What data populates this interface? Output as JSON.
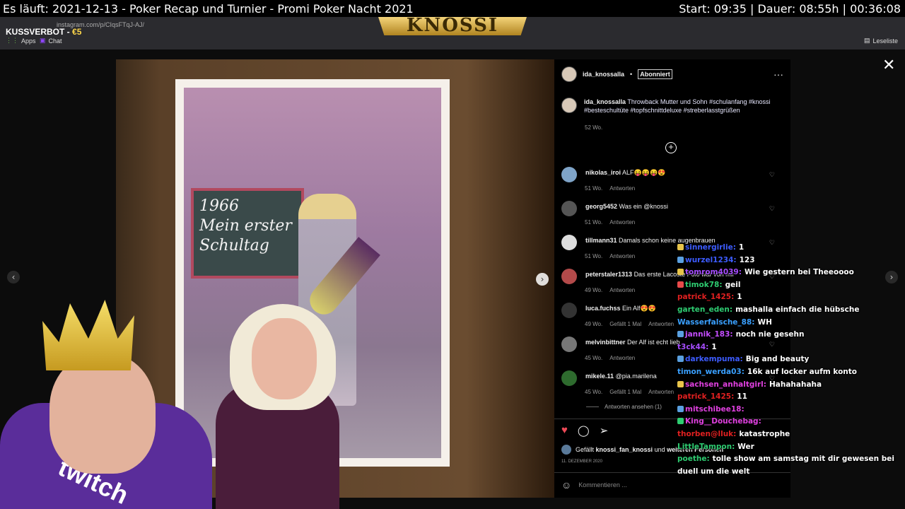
{
  "overlay": {
    "title": "Es läuft: 2021-12-13 - Poker Recap und Turnier - Promi Poker Nacht 2021",
    "time_info": "Start: 09:35 | Dauer: 08:55h | 00:36:08",
    "kuss_label": "KUSSVERBOT - ",
    "kuss_amount": "€5",
    "brand_logo": "KNOSSI"
  },
  "browser": {
    "url": "instagram.com/p/CIqsFTqJ-AJ/",
    "bookmarks": [
      "Apps",
      "Chat"
    ],
    "reading_list": "Leseliste"
  },
  "post": {
    "board_line1": "1966",
    "board_line2": "Mein erster",
    "board_line3": "Schultag"
  },
  "instagram": {
    "username": "ida_knossalla",
    "separator": "•",
    "follow_state": "Abonniert",
    "more": "···",
    "caption_user": "ida_knossalla",
    "caption_text": "Throwback Mutter und Sohn #schulanfang #knossi #besteschultüte #topfschnittdeluxe #streberlasstgrüßen",
    "caption_time": "52 Wo.",
    "comments": [
      {
        "user": "nikolas_iroi",
        "text": "ALF😝😝😝😍",
        "time": "51 Wo.",
        "likes": "",
        "reply": "Antworten",
        "avatar_color": "#7fa4c8"
      },
      {
        "user": "georg5452",
        "text": "Was ein @knossi",
        "time": "51 Wo.",
        "likes": "",
        "reply": "Antworten",
        "avatar_color": "#555"
      },
      {
        "user": "tillmann31",
        "text": "Damals schon keine augenbrauen",
        "time": "51 Wo.",
        "likes": "",
        "reply": "Antworten",
        "avatar_color": "#ddd"
      },
      {
        "user": "peterstaler1313",
        "text": "Das erste Lacoste Polo war von mir",
        "time": "49 Wo.",
        "likes": "",
        "reply": "Antworten",
        "avatar_color": "#b34a4a"
      },
      {
        "user": "luca.fuchss",
        "text": "Ein Alf😍😍",
        "time": "49 Wo.",
        "likes": "Gefällt 1 Mal",
        "reply": "Antworten",
        "avatar_color": "#333"
      },
      {
        "user": "melvinbittner",
        "text": "Der Alf ist echt lieb",
        "time": "45 Wo.",
        "likes": "",
        "reply": "Antworten",
        "avatar_color": "#777"
      },
      {
        "user": "mikele.11",
        "text": "@pia.marilena",
        "time": "45 Wo.",
        "likes": "Gefällt 1 Mal",
        "reply": "Antworten",
        "avatar_color": "#2e6b2e"
      }
    ],
    "view_replies": "Antworten ansehen (1)",
    "likes_prefix": "Gefällt ",
    "likes_user": "knossi_fan_knossi",
    "likes_mid": " und ",
    "likes_rest": "weiteren Personen",
    "date": "11. DEZEMBER 2020",
    "comment_placeholder": "Kommentieren ..."
  },
  "chat": [
    {
      "user": "sinnergirlie:",
      "text": "1",
      "color": "#3d5cff",
      "badge": "#e8c44a"
    },
    {
      "user": "wurzel1234:",
      "text": "123",
      "color": "#3d5cff",
      "badge": "#5aa0e0"
    },
    {
      "user": "tomrom4039:",
      "text": "Wie gestern bei Theeoooo",
      "color": "#a64dff",
      "badge": "#e8c44a"
    },
    {
      "user": "timok78:",
      "text": "geil",
      "color": "#2ecc71",
      "badge": "#e84a4a"
    },
    {
      "user": "patrick_1425:",
      "text": "1",
      "color": "#e02020",
      "badge": ""
    },
    {
      "user": "garten_eden:",
      "text": "mashalla einfach die hübsche",
      "color": "#2ecc71",
      "badge": ""
    },
    {
      "user": "Wasserfalsche_88:",
      "text": "WH",
      "color": "#3aa0ff",
      "badge": ""
    },
    {
      "user": "jannik_183:",
      "text": "noch nie gesehn",
      "color": "#c44dff",
      "badge": "#5aa0e0"
    },
    {
      "user": "t3ck44:",
      "text": "1",
      "color": "#a64dff",
      "badge": ""
    },
    {
      "user": "darkempuma:",
      "text": "Big and beauty",
      "color": "#3d5cff",
      "badge": "#5aa0e0"
    },
    {
      "user": "timon_werda03:",
      "text": "16k auf locker aufm konto",
      "color": "#3aa0ff",
      "badge": ""
    },
    {
      "user": "sachsen_anhaltgirl:",
      "text": "Hahahahaha",
      "color": "#e040e0",
      "badge": "#e8c44a"
    },
    {
      "user": "patrick_1425:",
      "text": "11",
      "color": "#e02020",
      "badge": ""
    },
    {
      "user": "mitschibee18:",
      "text": "",
      "color": "#e040e0",
      "badge": "#5aa0e0"
    },
    {
      "user": "King__Douchebag:",
      "text": "",
      "color": "#e040e0",
      "badge": "#2ecc71"
    },
    {
      "user": "thorben@lluk:",
      "text": "katastrophe",
      "color": "#e02020",
      "badge": ""
    },
    {
      "user": "LittleTampon:",
      "text": "Wer",
      "color": "#2ecc71",
      "badge": ""
    },
    {
      "user": "poethe:",
      "text": "tolle show am samstag mit dir gewesen bei duell um die welt",
      "color": "#2ecc71",
      "badge": ""
    }
  ],
  "webcam": {
    "shirt_text": "twitch"
  }
}
